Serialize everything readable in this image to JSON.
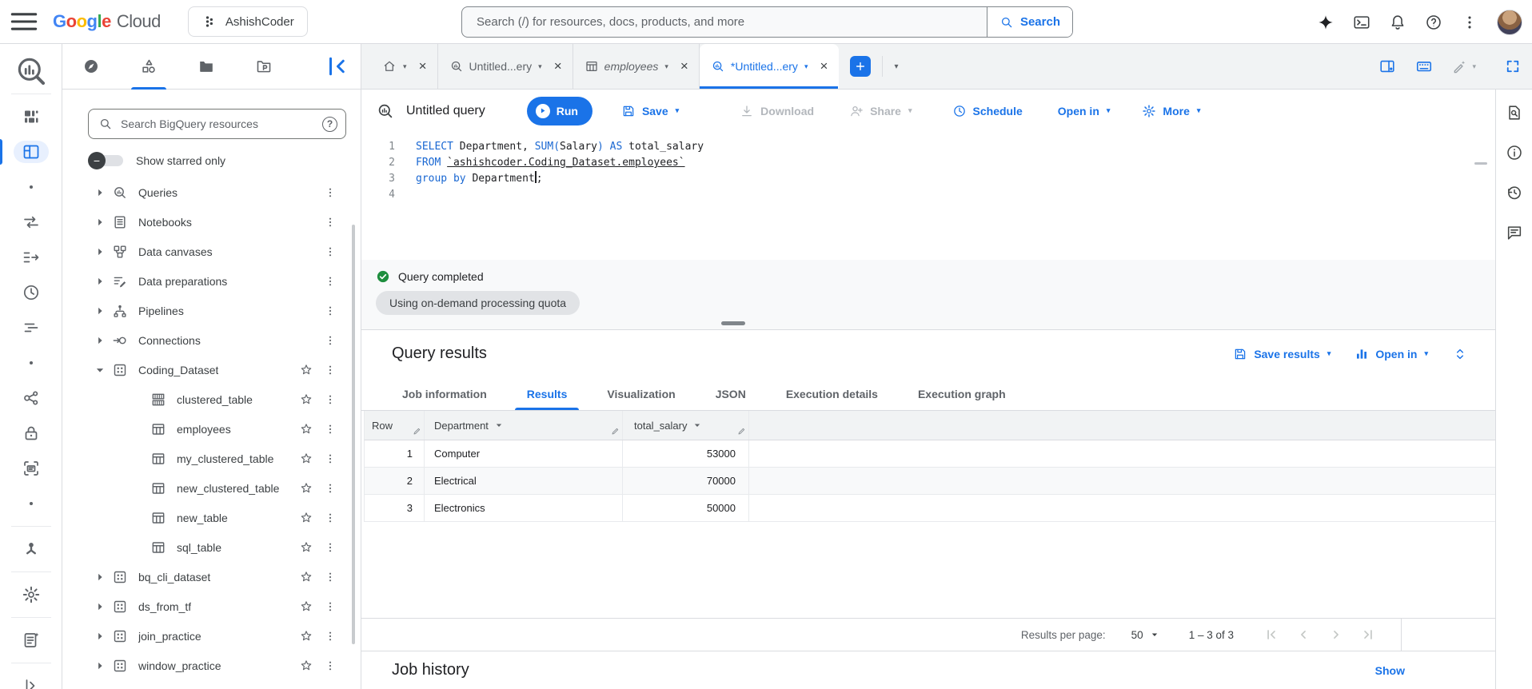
{
  "header": {
    "logo_google": "Google",
    "logo_cloud": "Cloud",
    "project_name": "AshishCoder",
    "search_placeholder": "Search (/) for resources, docs, products, and more",
    "search_button_label": "Search"
  },
  "left_rail": {
    "items": [
      {
        "name": "bigquery-logo",
        "icon": "bq-logo"
      },
      {
        "divider": true
      },
      {
        "name": "welcome",
        "icon": "welcome-blocks"
      },
      {
        "name": "workspace",
        "icon": "workspace",
        "selected": true
      },
      {
        "name": "section-dot-1",
        "icon": "dot"
      },
      {
        "name": "data-transfers",
        "icon": "transfers"
      },
      {
        "name": "migration",
        "icon": "migration"
      },
      {
        "name": "scheduling",
        "icon": "clock"
      },
      {
        "name": "monitoring",
        "icon": "monitoring"
      },
      {
        "name": "section-dot-2",
        "icon": "dot"
      },
      {
        "name": "analytics-hub",
        "icon": "analytics-hub"
      },
      {
        "name": "secure",
        "icon": "lock"
      },
      {
        "name": "data-policies",
        "icon": "frame"
      },
      {
        "name": "section-dot-3",
        "icon": "dot"
      },
      {
        "divider": true
      },
      {
        "name": "governance",
        "icon": "governance"
      },
      {
        "divider": true
      },
      {
        "name": "settings",
        "icon": "gear"
      },
      {
        "divider": true
      },
      {
        "name": "release-notes",
        "icon": "release-notes"
      },
      {
        "divider": true
      },
      {
        "name": "expand-nav",
        "icon": "expand-panel"
      }
    ]
  },
  "explorer": {
    "tabs": [
      {
        "name": "explorer-tab-featured",
        "icon": "compass"
      },
      {
        "name": "explorer-tab-studio",
        "icon": "shapes",
        "selected": true
      },
      {
        "name": "explorer-tab-projects",
        "icon": "folder"
      },
      {
        "name": "explorer-tab-repositories",
        "icon": "repository"
      }
    ],
    "search_placeholder": "Search BigQuery resources",
    "starred_toggle_label": "Show starred only",
    "tree": [
      {
        "label": "Queries",
        "icon": "query-mag",
        "caret": "right"
      },
      {
        "label": "Notebooks",
        "icon": "notebook",
        "caret": "right"
      },
      {
        "label": "Data canvases",
        "icon": "canvas",
        "caret": "right"
      },
      {
        "label": "Data preparations",
        "icon": "data-prep",
        "caret": "right"
      },
      {
        "label": "Pipelines",
        "icon": "pipeline",
        "caret": "right"
      },
      {
        "label": "Connections",
        "icon": "connection",
        "caret": "right"
      },
      {
        "label": "Coding_Dataset",
        "icon": "dataset",
        "caret": "down",
        "star": true
      },
      {
        "label": "clustered_table",
        "icon": "clustered-table",
        "child": true,
        "star": true
      },
      {
        "label": "employees",
        "icon": "table",
        "child": true,
        "star": true
      },
      {
        "label": "my_clustered_table",
        "icon": "table",
        "child": true,
        "star": true
      },
      {
        "label": "new_clustered_table",
        "icon": "table",
        "child": true,
        "star": true
      },
      {
        "label": "new_table",
        "icon": "table",
        "child": true,
        "star": true
      },
      {
        "label": "sql_table",
        "icon": "table",
        "child": true,
        "star": true
      },
      {
        "label": "bq_cli_dataset",
        "icon": "dataset",
        "caret": "right",
        "star": true
      },
      {
        "label": "ds_from_tf",
        "icon": "dataset",
        "caret": "right",
        "star": true
      },
      {
        "label": "join_practice",
        "icon": "dataset",
        "caret": "right",
        "star": true
      },
      {
        "label": "window_practice",
        "icon": "dataset",
        "caret": "right",
        "star": true
      }
    ]
  },
  "tab_strip": {
    "tabs": [
      {
        "name": "tab-home",
        "icon": "home",
        "label": ""
      },
      {
        "name": "tab-untitled-query-1",
        "icon": "query-mag",
        "label": "Untitled...ery"
      },
      {
        "name": "tab-employees",
        "icon": "table",
        "label": "employees",
        "italic": true
      },
      {
        "name": "tab-untitled-query-2",
        "icon": "query-mag",
        "label": "*Untitled...ery",
        "active": true
      }
    ]
  },
  "editor": {
    "title": "Untitled query",
    "run_label": "Run",
    "save_label": "Save",
    "download_label": "Download",
    "share_label": "Share",
    "schedule_label": "Schedule",
    "open_in_label": "Open in",
    "more_label": "More",
    "sql_lines": [
      [
        {
          "t": "kw",
          "v": "SELECT"
        },
        {
          "t": "pl",
          "v": " Department, "
        },
        {
          "t": "kw",
          "v": "SUM"
        },
        {
          "t": "kw",
          "v": "("
        },
        {
          "t": "pl",
          "v": "Salary"
        },
        {
          "t": "kw",
          "v": ")"
        },
        {
          "t": "pl",
          "v": " "
        },
        {
          "t": "kw",
          "v": "AS"
        },
        {
          "t": "pl",
          "v": " total_salary"
        }
      ],
      [
        {
          "t": "kw",
          "v": "FROM"
        },
        {
          "t": "pl",
          "v": " "
        },
        {
          "t": "lk",
          "v": "`ashishcoder.Coding_Dataset.employees`"
        }
      ],
      [
        {
          "t": "kw",
          "v": "group by"
        },
        {
          "t": "pl",
          "v": " Department"
        },
        {
          "t": "cur",
          "v": ""
        },
        {
          "t": "pl",
          "v": ";"
        }
      ],
      []
    ]
  },
  "status": {
    "message": "Query completed",
    "quota_chip": "Using on-demand processing quota"
  },
  "results": {
    "title": "Query results",
    "save_results_label": "Save results",
    "open_in_label": "Open in",
    "tabs": [
      "Job information",
      "Results",
      "Visualization",
      "JSON",
      "Execution details",
      "Execution graph"
    ],
    "active_tab": "Results",
    "table": {
      "columns": [
        "Row",
        "Department",
        "total_salary"
      ],
      "rows": [
        [
          "1",
          "Computer",
          "53000"
        ],
        [
          "2",
          "Electrical",
          "70000"
        ],
        [
          "3",
          "Electronics",
          "50000"
        ]
      ]
    },
    "pagination": {
      "label": "Results per page:",
      "page_size": "50",
      "range": "1 – 3 of 3"
    }
  },
  "job_history": {
    "title": "Job history",
    "show_label": "Show"
  },
  "colors": {
    "accent_blue": "#1a73e8",
    "keyword_blue": "#1967d2",
    "success_green": "#1e8e3e"
  }
}
